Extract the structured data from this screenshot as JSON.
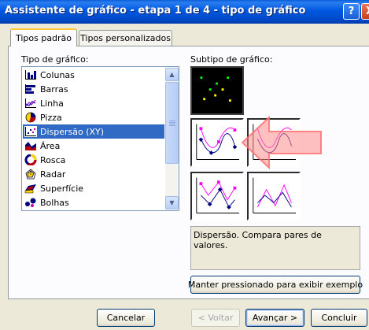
{
  "window": {
    "title": "Assistente de gráfico - etapa 1 de 4 - tipo de gráfico",
    "help_label": "?",
    "close_label": "X"
  },
  "tabs": [
    {
      "label": "Tipos padrão",
      "active": true
    },
    {
      "label": "Tipos personalizados",
      "active": false
    }
  ],
  "chart_type": {
    "label": "Tipo de gráfico:",
    "items": [
      {
        "label": "Colunas",
        "icon": "column-chart-icon"
      },
      {
        "label": "Barras",
        "icon": "bar-chart-icon"
      },
      {
        "label": "Linha",
        "icon": "line-chart-icon"
      },
      {
        "label": "Pizza",
        "icon": "pie-chart-icon"
      },
      {
        "label": "Dispersão (XY)",
        "icon": "scatter-chart-icon",
        "selected": true
      },
      {
        "label": "Área",
        "icon": "area-chart-icon"
      },
      {
        "label": "Rosca",
        "icon": "doughnut-chart-icon"
      },
      {
        "label": "Radar",
        "icon": "radar-chart-icon"
      },
      {
        "label": "Superfície",
        "icon": "surface-chart-icon"
      },
      {
        "label": "Bolhas",
        "icon": "bubble-chart-icon"
      }
    ]
  },
  "subtype": {
    "label": "Subtipo de gráfico:",
    "description": "Dispersão. Compara pares de valores."
  },
  "buttons": {
    "preview": "Manter pressionado para exibir exemplo",
    "cancel": "Cancelar",
    "back": "< Voltar",
    "next": "Avançar >",
    "finish": "Concluir"
  },
  "colors": {
    "selection": "#316ac5",
    "title_bar": "#0058e0",
    "highlight_arrow": "#ff8c8c"
  }
}
